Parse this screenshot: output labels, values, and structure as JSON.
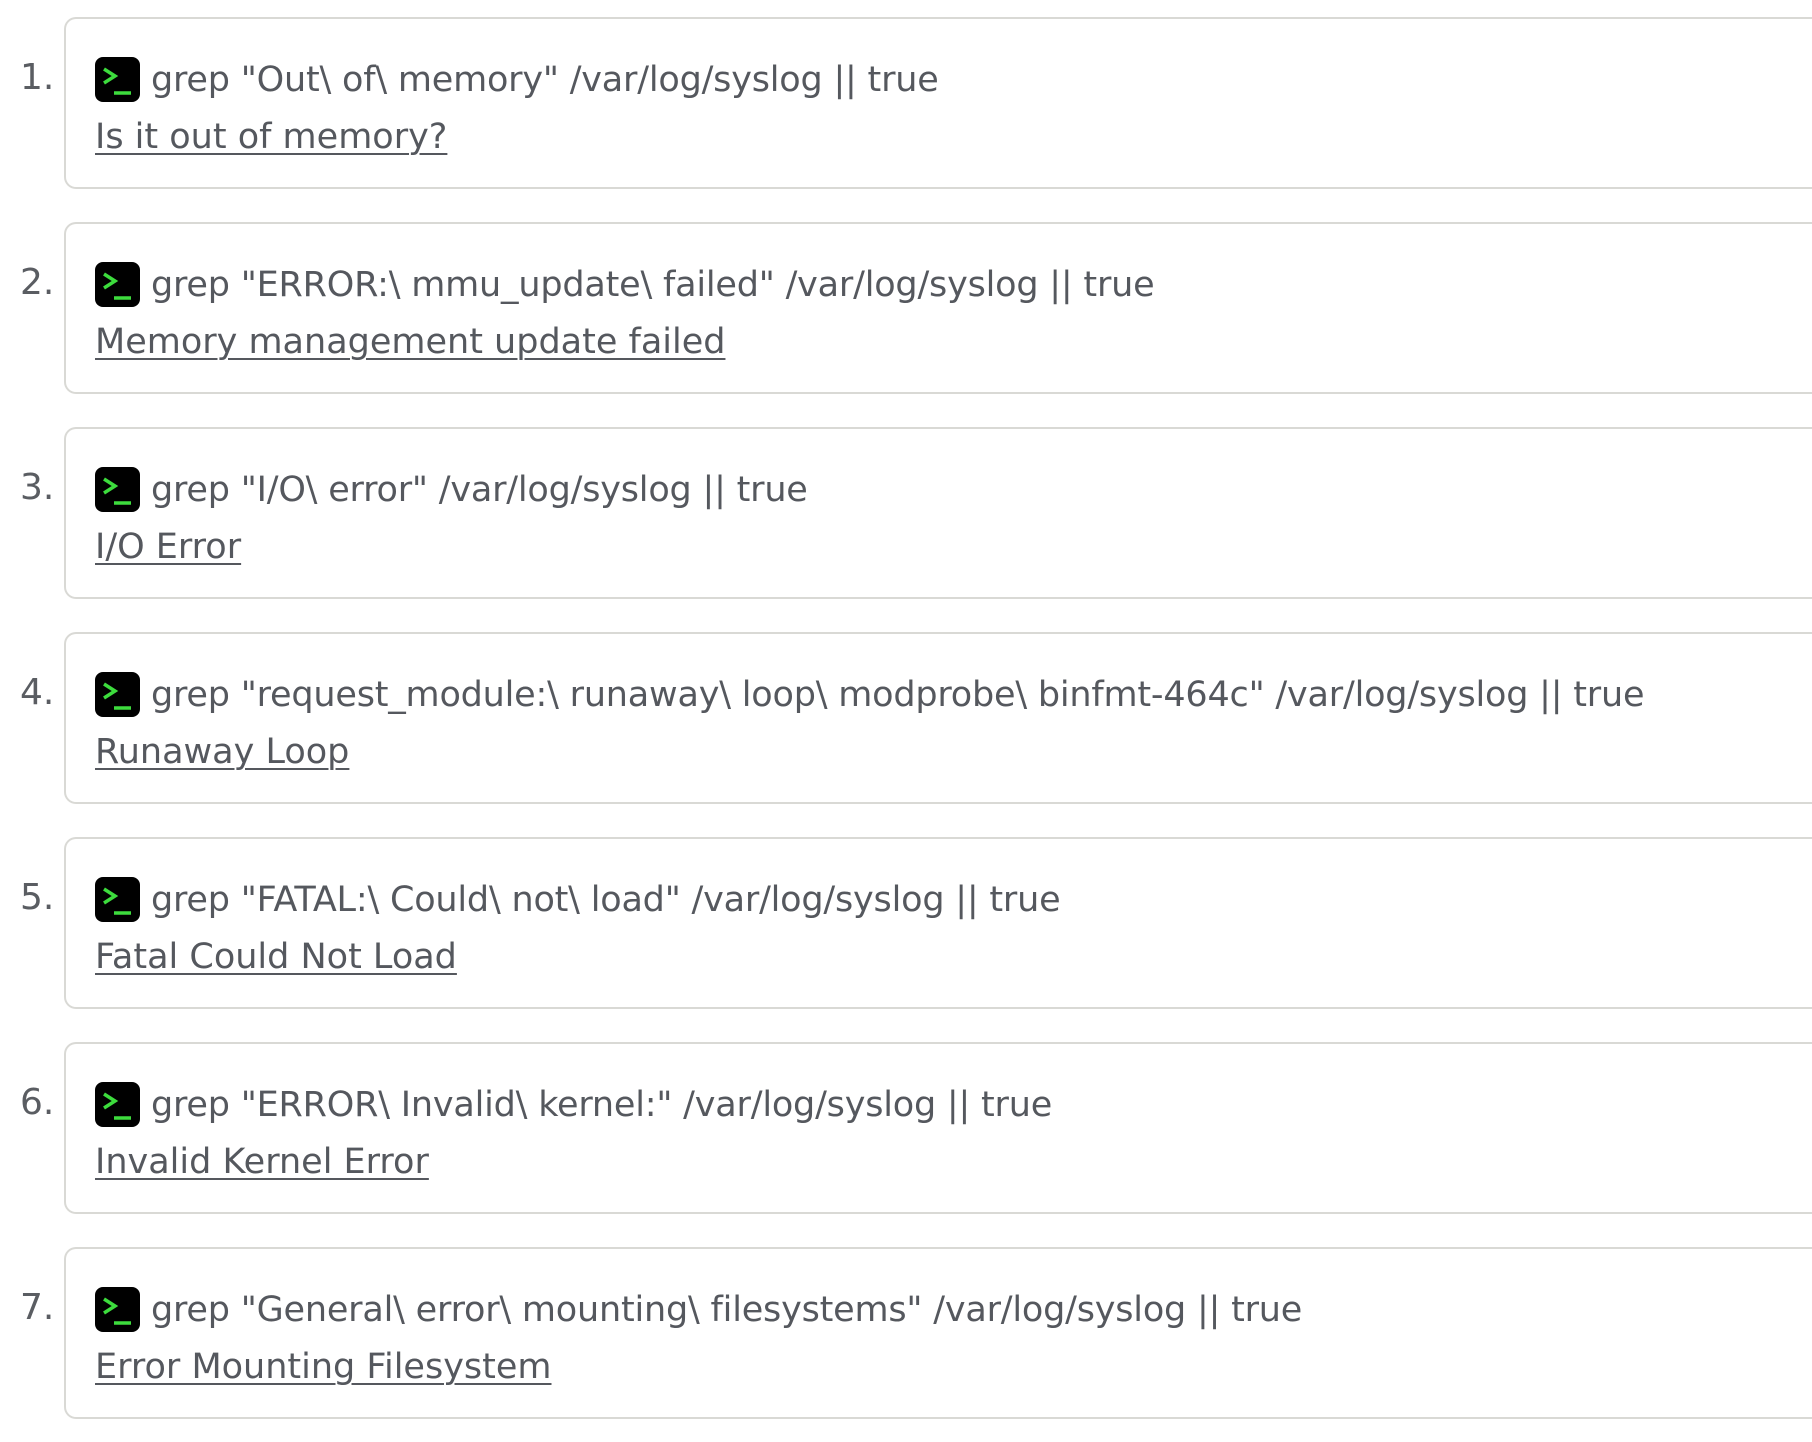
{
  "items": [
    {
      "number": "1.",
      "command": "grep \"Out\\ of\\ memory\" /var/log/syslog || true",
      "link": "Is it out of memory?"
    },
    {
      "number": "2.",
      "command": "grep \"ERROR:\\ mmu_update\\ failed\" /var/log/syslog || true",
      "link": "Memory management update failed"
    },
    {
      "number": "3.",
      "command": "grep \"I/O\\ error\" /var/log/syslog || true",
      "link": "I/O Error"
    },
    {
      "number": "4.",
      "command": "grep \"request_module:\\ runaway\\ loop\\ modprobe\\ binfmt-464c\" /var/log/syslog || true",
      "link": "Runaway Loop"
    },
    {
      "number": "5.",
      "command": "grep \"FATAL:\\ Could\\ not\\ load\" /var/log/syslog || true",
      "link": "Fatal Could Not Load"
    },
    {
      "number": "6.",
      "command": "grep \"ERROR\\ Invalid\\ kernel:\" /var/log/syslog || true",
      "link": "Invalid Kernel Error"
    },
    {
      "number": "7.",
      "command": "grep \"General\\ error\\ mounting\\ filesystems\" /var/log/syslog || true",
      "link": "Error Mounting Filesystem"
    }
  ],
  "icons": {
    "command": "terminal-icon"
  },
  "colors": {
    "terminal_bg": "#000000",
    "terminal_prompt": "#3ddc3d",
    "text": "#55585e",
    "border": "#d9d9d5"
  }
}
